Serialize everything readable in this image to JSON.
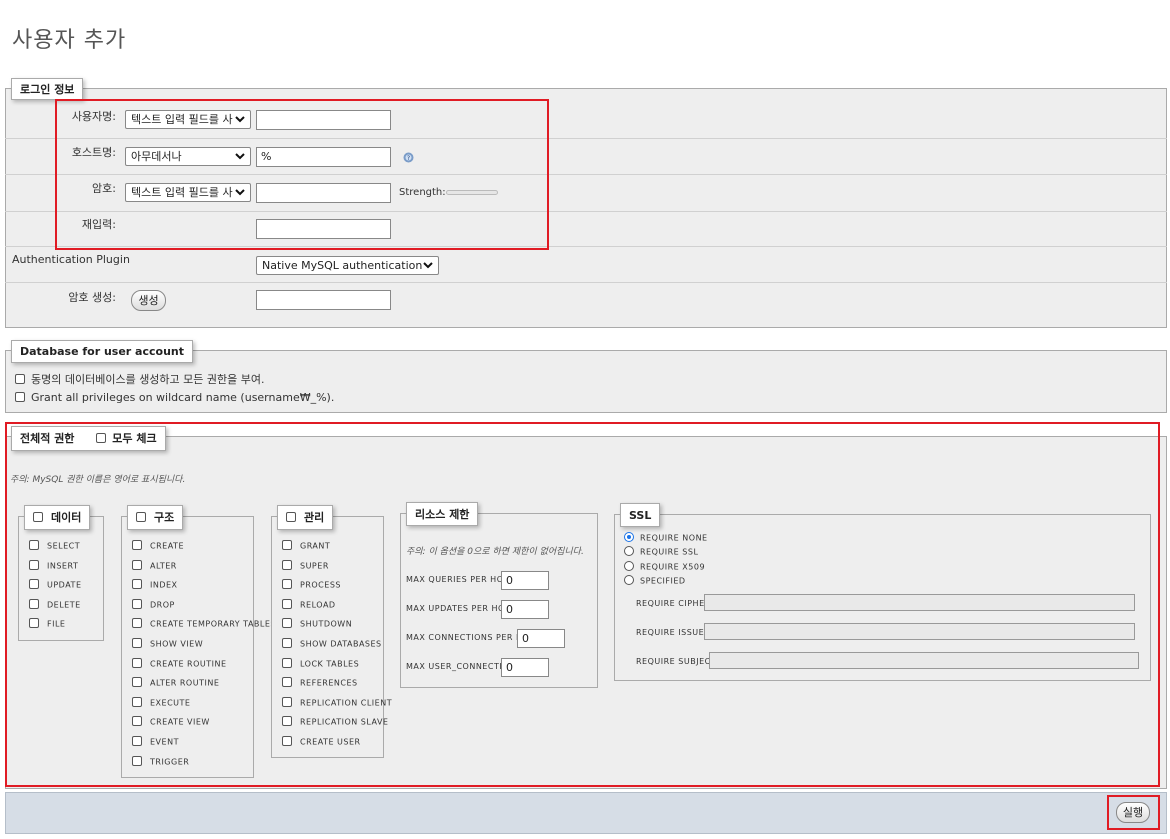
{
  "page": {
    "title": "사용자 추가"
  },
  "login": {
    "legend": "로그인 정보",
    "username": {
      "label": "사용자명:",
      "select": "텍스트 입력 필드를 사",
      "value": ""
    },
    "host": {
      "label": "호스트명:",
      "select": "아무데서나",
      "value": "%"
    },
    "password": {
      "label": "암호:",
      "select": "텍스트 입력 필드를 사",
      "value": "",
      "strength_label": "Strength:"
    },
    "retype": {
      "label": "재입력:",
      "value": ""
    },
    "auth_plugin": {
      "label": "Authentication Plugin",
      "select": "Native MySQL authentication"
    },
    "generate": {
      "label": "암호 생성:",
      "button": "생성",
      "value": ""
    }
  },
  "database": {
    "legend": "Database for user account",
    "options": [
      "동명의 데이터베이스를 생성하고 모든 권한을 부여.",
      "Grant all privileges on wildcard name (username₩_%)."
    ]
  },
  "global": {
    "legend": "전체적 권한",
    "check_all": "모두 체크",
    "note": "주의: MySQL 권한 이름은 영어로 표시됩니다.",
    "data": {
      "title": "데이터",
      "items": [
        "SELECT",
        "INSERT",
        "UPDATE",
        "DELETE",
        "FILE"
      ]
    },
    "structure": {
      "title": "구조",
      "items": [
        "CREATE",
        "ALTER",
        "INDEX",
        "DROP",
        "CREATE TEMPORARY TABLES",
        "SHOW VIEW",
        "CREATE ROUTINE",
        "ALTER ROUTINE",
        "EXECUTE",
        "CREATE VIEW",
        "EVENT",
        "TRIGGER"
      ]
    },
    "admin": {
      "title": "관리",
      "items": [
        "GRANT",
        "SUPER",
        "PROCESS",
        "RELOAD",
        "SHUTDOWN",
        "SHOW DATABASES",
        "LOCK TABLES",
        "REFERENCES",
        "REPLICATION CLIENT",
        "REPLICATION SLAVE",
        "CREATE USER"
      ]
    },
    "resource": {
      "title": "리소스 제한",
      "note": "주의: 이 옵션을 0으로 하면 제한이 없어집니다.",
      "items": [
        {
          "label": "MAX QUERIES PER HOUR",
          "value": "0"
        },
        {
          "label": "MAX UPDATES PER HOUR",
          "value": "0"
        },
        {
          "label": "MAX CONNECTIONS PER HOUR",
          "value": "0"
        },
        {
          "label": "MAX USER_CONNECTIONS",
          "value": "0"
        }
      ]
    },
    "ssl": {
      "title": "SSL",
      "options": [
        "REQUIRE NONE",
        "REQUIRE SSL",
        "REQUIRE X509",
        "SPECIFIED"
      ],
      "selected": "REQUIRE NONE",
      "fields": [
        "REQUIRE CIPHER",
        "REQUIRE ISSUER",
        "REQUIRE SUBJECT"
      ]
    }
  },
  "footer": {
    "submit": "실행"
  },
  "colors": {
    "highlight": "#e01b24",
    "fieldset_bg": "#eeeeee",
    "footer_bg": "#d6dde6",
    "radio_accent": "#1a73e8"
  }
}
